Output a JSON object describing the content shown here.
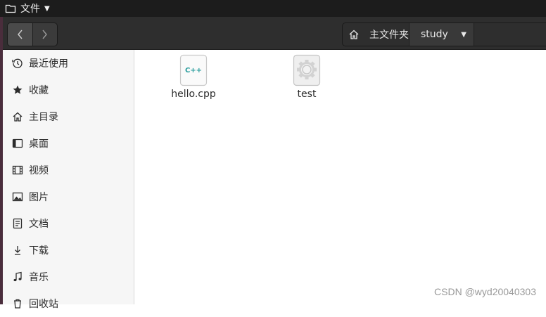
{
  "topbar": {
    "app_label": "文件"
  },
  "header": {
    "path": {
      "home_label": "主文件夹",
      "current_label": "study"
    }
  },
  "sidebar": {
    "items": [
      {
        "label": "最近使用",
        "icon": "clock-icon"
      },
      {
        "label": "收藏",
        "icon": "star-icon"
      },
      {
        "label": "主目录",
        "icon": "home-icon"
      },
      {
        "label": "桌面",
        "icon": "desktop-icon"
      },
      {
        "label": "视频",
        "icon": "film-icon"
      },
      {
        "label": "图片",
        "icon": "picture-icon"
      },
      {
        "label": "文档",
        "icon": "document-icon"
      },
      {
        "label": "下载",
        "icon": "download-icon"
      },
      {
        "label": "音乐",
        "icon": "music-icon"
      },
      {
        "label": "回收站",
        "icon": "trash-icon"
      }
    ]
  },
  "files": [
    {
      "name": "hello.cpp",
      "icon_text": "C++",
      "icon": "cpp-file-icon"
    },
    {
      "name": "test",
      "icon": "executable-gear-icon"
    }
  ],
  "watermark": "CSDN @wyd20040303",
  "colors": {
    "topbar": "#1c1c1c",
    "headerbar": "#2e2e2e",
    "sidebar": "#f6f6f6",
    "cpp_teal": "#2a9d9d"
  }
}
